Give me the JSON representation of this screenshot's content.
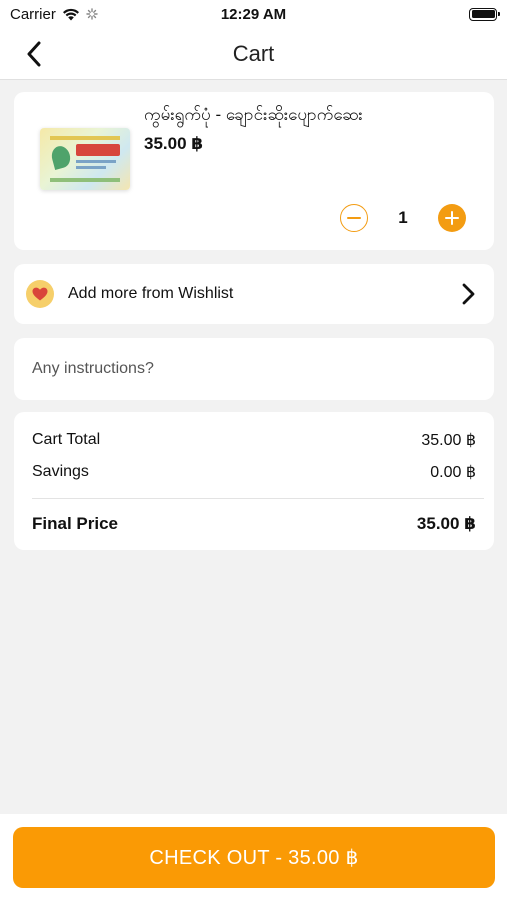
{
  "status_bar": {
    "carrier": "Carrier",
    "time": "12:29 AM"
  },
  "nav": {
    "title": "Cart",
    "back_icon": "chevron-left-icon"
  },
  "cart_items": [
    {
      "name": "ကွမ်းရွက်ပုံ - ချောင်းဆိုးပျောက်ဆေး",
      "price": "35.00 ฿",
      "quantity": "1"
    }
  ],
  "wishlist": {
    "label": "Add more from Wishlist",
    "icon": "heart-icon"
  },
  "instructions": {
    "placeholder": "Any instructions?",
    "value": ""
  },
  "summary": {
    "cart_total_label": "Cart Total",
    "cart_total_value": "35.00 ฿",
    "savings_label": "Savings",
    "savings_value": "0.00 ฿",
    "final_price_label": "Final Price",
    "final_price_value": "35.00 ฿"
  },
  "checkout": {
    "label": "CHECK OUT - 35.00 ฿"
  },
  "colors": {
    "accent": "#fa9a05",
    "background": "#f2f2f2",
    "card": "#ffffff"
  }
}
